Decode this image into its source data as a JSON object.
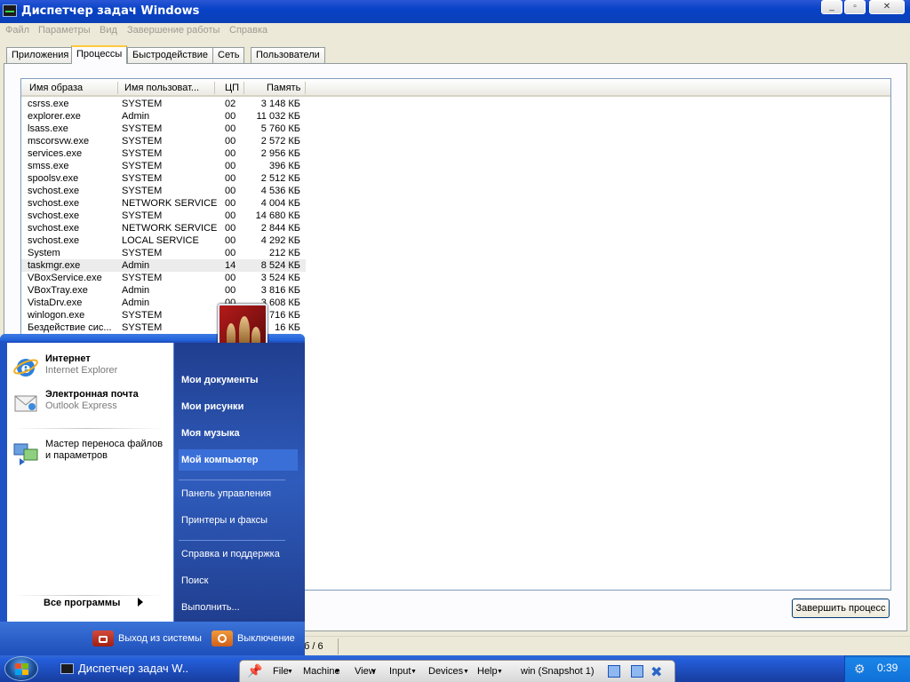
{
  "window": {
    "title": "Диспетчер задач Windows"
  },
  "menu": [
    "Файл",
    "Параметры",
    "Вид",
    "Завершение работы",
    "Справка"
  ],
  "tabs": [
    "Приложения",
    "Процессы",
    "Быстродействие",
    "Сеть",
    "Пользователи"
  ],
  "columns": [
    "Имя образа",
    "Имя пользоват...",
    "ЦП",
    "Память"
  ],
  "processes": [
    [
      "csrss.exe",
      "SYSTEM",
      "02",
      "3 148 КБ"
    ],
    [
      "explorer.exe",
      "Admin",
      "00",
      "11 032 КБ"
    ],
    [
      "lsass.exe",
      "SYSTEM",
      "00",
      "5 760 КБ"
    ],
    [
      "mscorsvw.exe",
      "SYSTEM",
      "00",
      "2 572 КБ"
    ],
    [
      "services.exe",
      "SYSTEM",
      "00",
      "2 956 КБ"
    ],
    [
      "smss.exe",
      "SYSTEM",
      "00",
      "396 КБ"
    ],
    [
      "spoolsv.exe",
      "SYSTEM",
      "00",
      "2 512 КБ"
    ],
    [
      "svchost.exe",
      "SYSTEM",
      "00",
      "4 536 КБ"
    ],
    [
      "svchost.exe",
      "NETWORK SERVICE",
      "00",
      "4 004 КБ"
    ],
    [
      "svchost.exe",
      "SYSTEM",
      "00",
      "14 680 КБ"
    ],
    [
      "svchost.exe",
      "NETWORK SERVICE",
      "00",
      "2 844 КБ"
    ],
    [
      "svchost.exe",
      "LOCAL SERVICE",
      "00",
      "4 292 КБ"
    ],
    [
      "System",
      "SYSTEM",
      "00",
      "212 КБ"
    ],
    [
      "taskmgr.exe",
      "Admin",
      "14",
      "8 524 КБ"
    ],
    [
      "VBoxService.exe",
      "SYSTEM",
      "00",
      "3 524 КБ"
    ],
    [
      "VBoxTray.exe",
      "Admin",
      "00",
      "3 816 КБ"
    ],
    [
      "VistaDrv.exe",
      "Admin",
      "00",
      "3 608 КБ"
    ],
    [
      "winlogon.exe",
      "SYSTEM",
      "00",
      "6 716 КБ"
    ],
    [
      "Бездействие сис...",
      "SYSTEM",
      "",
      "16 КБ"
    ]
  ],
  "end_process_label": "Завершить процесс",
  "status": {
    "fragment": "б / 6"
  },
  "start_menu": {
    "pinned": [
      {
        "title": "Интернет",
        "subtitle": "Internet Explorer",
        "icon": "internet-explorer-icon"
      },
      {
        "title": "Электронная почта",
        "subtitle": "Outlook Express",
        "icon": "outlook-express-icon"
      }
    ],
    "recent": [
      {
        "title": "Мастер переноса файлов и параметров",
        "icon": "transfer-wizard-icon"
      }
    ],
    "all_programs": "Все программы",
    "places": [
      "Мои документы",
      "Мои рисунки",
      "Моя музыка",
      "Мой компьютер"
    ],
    "settings": [
      "Панель управления",
      "Принтеры и факсы"
    ],
    "tools": [
      "Справка и поддержка",
      "Поиск",
      "Выполнить..."
    ],
    "logoff": "Выход из системы",
    "shutdown": "Выключение"
  },
  "taskbar": {
    "task": "Диспетчер задач W...",
    "clock": "0:39"
  },
  "vbox": {
    "menus": [
      "File",
      "Machine",
      "View",
      "Input",
      "Devices",
      "Help"
    ],
    "vm": "win (Snapshot 1)"
  },
  "colors": {
    "title_bar": "#0842c6",
    "taskbar": "#245edb",
    "start_menu_right": "#2f5cbc",
    "selected_tab": "#ffc83c"
  }
}
